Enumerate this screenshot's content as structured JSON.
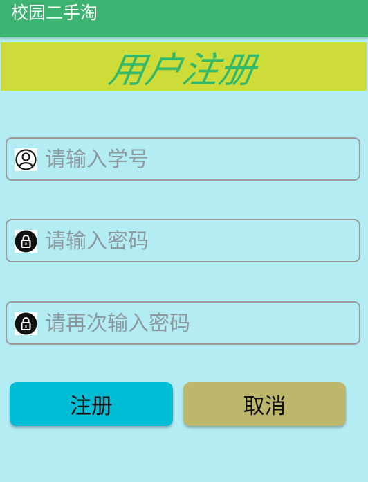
{
  "app_bar": {
    "title": "校园二手淘"
  },
  "banner": {
    "title": "用户注册"
  },
  "form": {
    "fields": [
      {
        "icon": "user-icon",
        "placeholder": "请输入学号",
        "value": ""
      },
      {
        "icon": "lock-icon",
        "placeholder": "请输入密码",
        "value": ""
      },
      {
        "icon": "lock-icon",
        "placeholder": "请再次输入密码",
        "value": ""
      }
    ]
  },
  "buttons": {
    "register_label": "注册",
    "cancel_label": "取消"
  },
  "colors": {
    "app_bar": "#3cb371",
    "background": "#b3ecf2",
    "banner_bg": "#cddc39",
    "banner_text": "#33b86a",
    "register_button": "#00bcd4",
    "cancel_button": "#bdb76b"
  }
}
